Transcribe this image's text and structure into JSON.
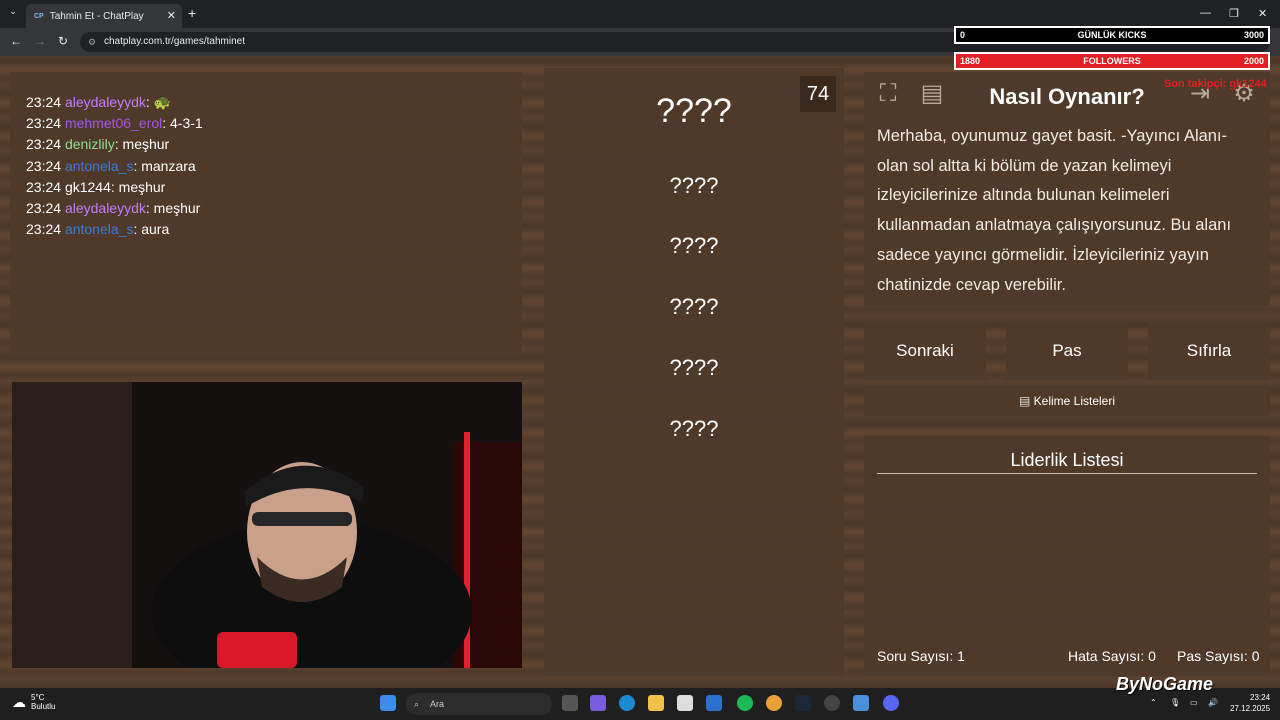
{
  "browser": {
    "tab_title": "Tahmin Et - ChatPlay",
    "tab_favicon": "CP",
    "url": "chatplay.com.tr/games/tahminet"
  },
  "overlay": {
    "kicks_left": "0",
    "kicks_label": "GÜNLÜK KICKS",
    "kicks_right": "3000",
    "followers_left": "1880",
    "followers_label": "FOLLOWERS",
    "followers_right": "2000",
    "red_text": "Son takipçi: gk1244",
    "brand": "ByNoGame"
  },
  "chat": {
    "messages": [
      {
        "time": "23:24",
        "user": "aleydaleyydk",
        "text": "🐢",
        "color": "#c57bff"
      },
      {
        "time": "23:24",
        "user": "mehmet06_erol",
        "text": "4-3-1",
        "color": "#a456e8"
      },
      {
        "time": "23:24",
        "user": "denizlily",
        "text": "meşhur",
        "color": "#8be38b"
      },
      {
        "time": "23:24",
        "user": "antonela_s",
        "text": "manzara",
        "color": "#3d7bd9"
      },
      {
        "time": "23:24",
        "user": "gk1244",
        "text": "meşhur",
        "color": "#ffffff"
      },
      {
        "time": "23:24",
        "user": "aleydaleyydk",
        "text": "meşhur",
        "color": "#c57bff"
      },
      {
        "time": "23:24",
        "user": "antonela_s",
        "text": "aura",
        "color": "#3d7bd9"
      }
    ]
  },
  "game": {
    "timer": "74",
    "main_word": "????",
    "forbidden_words": [
      "????",
      "????",
      "????",
      "????",
      "????"
    ],
    "info_title": "Nasıl Oynanır?",
    "info_text": "Merhaba, oyunumuz gayet basit. -Yayıncı Alanı- olan sol altta ki bölüm de yazan kelimeyi izleyicilerinize altında bulunan kelimeleri kullanmadan anlatmaya çalışıyorsunuz. Bu alanı sadece yayıncı görmelidir. İzleyicileriniz yayın chatinizde cevap verebilir.",
    "buttons": {
      "next": "Sonraki",
      "pass": "Pas",
      "reset": "Sıfırla"
    },
    "word_lists_label": "Kelime Listeleri",
    "leaderboard_title": "Liderlik Listesi",
    "stats": {
      "questions": "Soru Sayısı: 1",
      "errors": "Hata Sayısı: 0",
      "passes": "Pas Sayısı: 0"
    }
  },
  "taskbar": {
    "temp": "5°C",
    "condition": "Bulutlu",
    "search_placeholder": "Ara",
    "time": "23:24",
    "date": "27.12.2025"
  }
}
